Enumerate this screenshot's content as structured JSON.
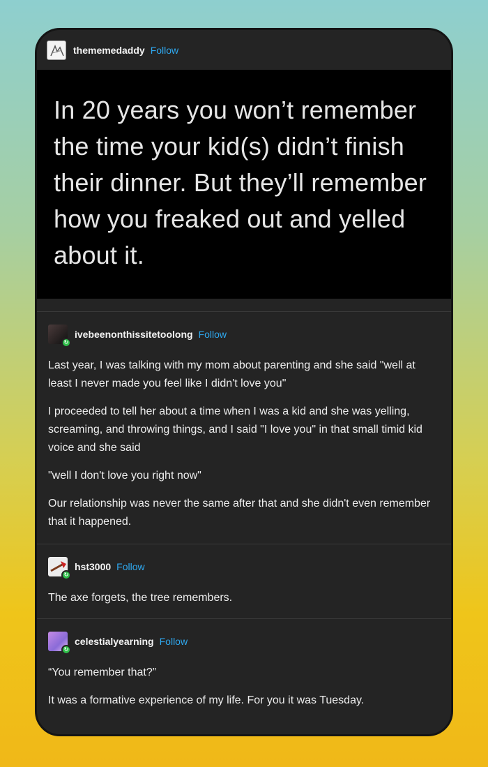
{
  "post": {
    "author": "thememedaddy",
    "follow_label": "Follow",
    "quote": "In 20 years you won’t remember the time your kid(s) didn’t finish their dinner. But they’ll remember how you freaked out and yelled about it."
  },
  "reblogs": [
    {
      "author": "ivebeenonthissitetoolong",
      "follow_label": "Follow",
      "paragraphs": [
        "Last year, I was talking with my mom about parenting and she said \"well at least I never made you feel like I didn't love you\"",
        "I proceeded to tell her about a time when I was a kid and she was yelling, screaming, and throwing things, and I said \"I love you\" in that small timid kid voice and she said",
        "\"well I don't love you right now\"",
        "Our relationship was never the same after that and she didn't even remember that it happened."
      ]
    },
    {
      "author": "hst3000",
      "follow_label": "Follow",
      "paragraphs": [
        "The axe forgets, the tree remembers."
      ]
    },
    {
      "author": "celestialyearning",
      "follow_label": "Follow",
      "paragraphs": [
        "“You remember that?”",
        "It was a formative experience of my life. For you it was Tuesday."
      ]
    }
  ],
  "colors": {
    "card_bg": "#242424",
    "quote_bg": "#000000",
    "follow_link": "#2fa8ef",
    "badge": "#2fbf4a"
  },
  "icons": {
    "op_avatar": "sketch-avatar-icon",
    "reblog_badge": "reblog-badge-icon"
  }
}
